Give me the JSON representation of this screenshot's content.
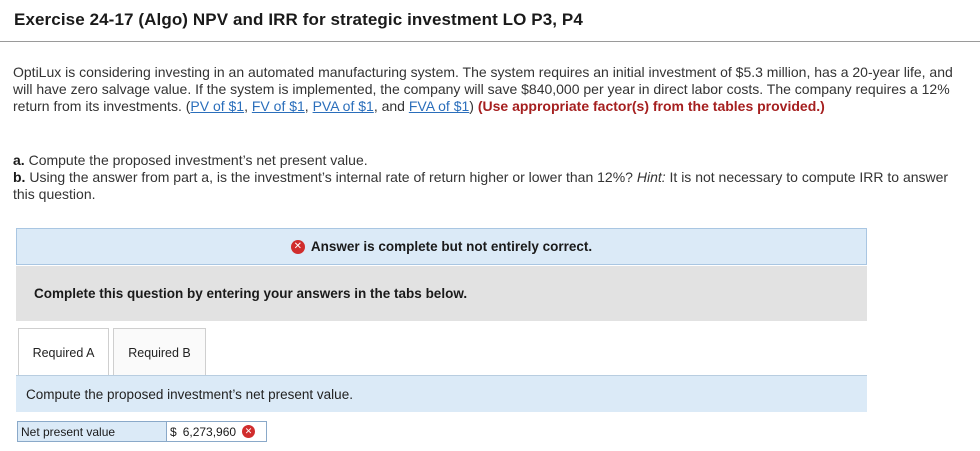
{
  "header": {
    "title": "Exercise 24-17 (Algo) NPV and IRR for strategic investment LO P3, P4"
  },
  "problem": {
    "intro": "OptiLux is considering investing in an automated manufacturing system. The system requires an initial investment of $5.3 million, has a 20-year life, and will have zero salvage value. If the system is implemented, the company will save $840,000 per year in direct labor costs. The company requires a 12% return from its investments. (",
    "links": {
      "pv": "PV of $1",
      "fv": "FV of $1",
      "pva": "PVA of $1",
      "fva": "FVA of $1"
    },
    "sep_comma": ", ",
    "sep_and": ", and ",
    "close_paren": ") ",
    "warning": "(Use appropriate factor(s) from the tables provided.)"
  },
  "questions": {
    "a_label": "a.",
    "a_text": " Compute the proposed investment’s net present value.",
    "b_label": "b.",
    "b_text": " Using the answer from part a, is the investment’s internal rate of return higher or lower than 12%? ",
    "hint_label": "Hint:",
    "hint_text": " It is not necessary to compute IRR to answer this question."
  },
  "status": {
    "icon": "x-circle-icon",
    "text": "Answer is complete but not entirely correct.",
    "icon_color": "#d02d2d"
  },
  "instruction": "Complete this question by entering your answers in the tabs below.",
  "tabs": [
    {
      "label": "Required A",
      "active": true
    },
    {
      "label": "Required B",
      "active": false
    }
  ],
  "required_a": {
    "prompt": "Compute the proposed investment’s net present value.",
    "field_label": "Net present value",
    "currency": "$",
    "value": "6,273,960",
    "mark": "incorrect"
  },
  "colors": {
    "accent_blue": "#dbeaf7",
    "warning_red": "#a51f1f",
    "link_blue": "#2a6ebb"
  }
}
